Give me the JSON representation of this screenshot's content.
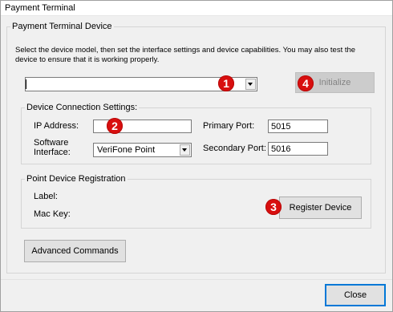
{
  "window": {
    "title": "Payment Terminal"
  },
  "device_group": {
    "legend": "Payment Terminal Device",
    "instructions": "Select the device model, then set the interface settings and device capabilities.  You may also test the device to ensure that it is working properly.",
    "device_model_value": "",
    "initialize_label": "Initialize"
  },
  "connection": {
    "legend": "Device Connection Settings:",
    "ip_label": "IP Address:",
    "ip_value": "",
    "software_label_line1": "Software",
    "software_label_line2": "Interface:",
    "software_value": "VeriFone Point",
    "primary_port_label": "Primary Port:",
    "primary_port_value": "5015",
    "secondary_port_label": "Secondary Port:",
    "secondary_port_value": "5016"
  },
  "registration": {
    "legend": "Point Device Registration",
    "label_label": "Label:",
    "mac_key_label": "Mac Key:",
    "register_label": "Register Device"
  },
  "advanced_commands_label": "Advanced Commands",
  "close_label": "Close",
  "callouts": [
    "1",
    "2",
    "3",
    "4"
  ],
  "colors": {
    "callout": "#d80f0f",
    "window_bg": "#f0f0f0",
    "default_button_border": "#0078d7"
  }
}
